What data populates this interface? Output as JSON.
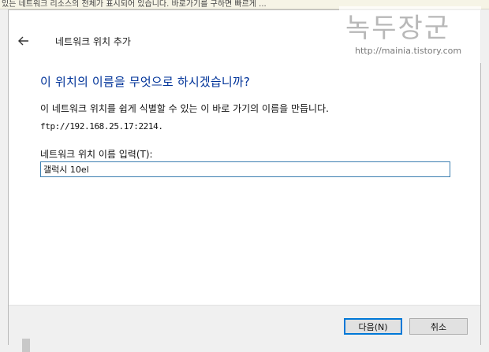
{
  "background": {
    "strip_text": "있는 네트워크 리소스의 전체가 표시되어 있습니다. 바로가기를 구하면 빠르게 ..."
  },
  "wizard": {
    "title": "네트워크 위치 추가",
    "heading": "이 위치의 이름을 무엇으로 하시겠습니까?",
    "description": "이 네트워크 위치를 쉽게 식별할 수 있는 이 바로 가기의 이름을 만듭니다.",
    "address": "ftp://192.168.25.17:2214.",
    "field_label": "네트워크 위치 이름 입력(T):",
    "field_value": "갤럭시 10el",
    "next_label": "다음(N)",
    "cancel_label": "취소"
  },
  "watermark": {
    "logo": "녹두장군",
    "url": "http://mainia.tistory.com"
  },
  "colors": {
    "heading": "#003399",
    "input_border": "#3c7fb1",
    "default_button_border": "#0078d7"
  },
  "icons": {
    "back": "back-arrow-icon"
  }
}
